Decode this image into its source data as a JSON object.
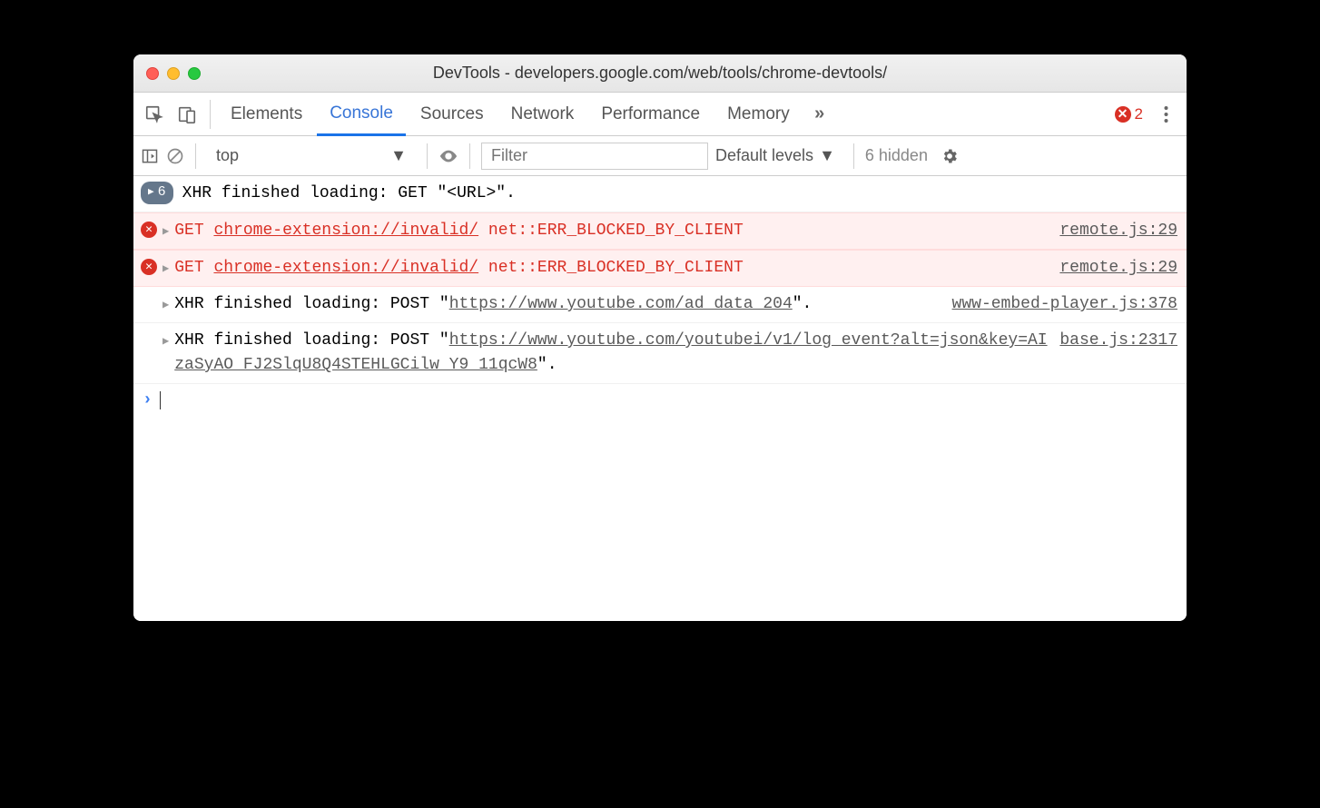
{
  "window": {
    "title": "DevTools - developers.google.com/web/tools/chrome-devtools/"
  },
  "tabs": [
    "Elements",
    "Console",
    "Sources",
    "Network",
    "Performance",
    "Memory"
  ],
  "activeTab": "Console",
  "errorCount": "2",
  "toolbar": {
    "context": "top",
    "filterPlaceholder": "Filter",
    "levels": "Default levels",
    "hidden": "6 hidden"
  },
  "logs": {
    "row0": {
      "count": "6",
      "text": "XHR finished loading: GET \"<URL>\"."
    },
    "row1": {
      "method": "GET",
      "url": "chrome-extension://invalid/",
      "err": "net::ERR_BLOCKED_BY_CLIENT",
      "source": "remote.js:29"
    },
    "row2": {
      "method": "GET",
      "url": "chrome-extension://invalid/",
      "err": "net::ERR_BLOCKED_BY_CLIENT",
      "source": "remote.js:29"
    },
    "row3": {
      "prefix": "XHR finished loading: POST \"",
      "url": "https://www.youtube.com/ad_data_204",
      "suffix": "\".",
      "source": "www-embed-player.js:378"
    },
    "row4": {
      "prefix": "XHR finished loading: POST \"",
      "url": "https://www.youtube.com/youtubei/v1/log_event?alt=json&key=AIzaSyAO_FJ2SlqU8Q4STEHLGCilw_Y9_11qcW8",
      "suffix": "\".",
      "source": "base.js:2317"
    }
  }
}
